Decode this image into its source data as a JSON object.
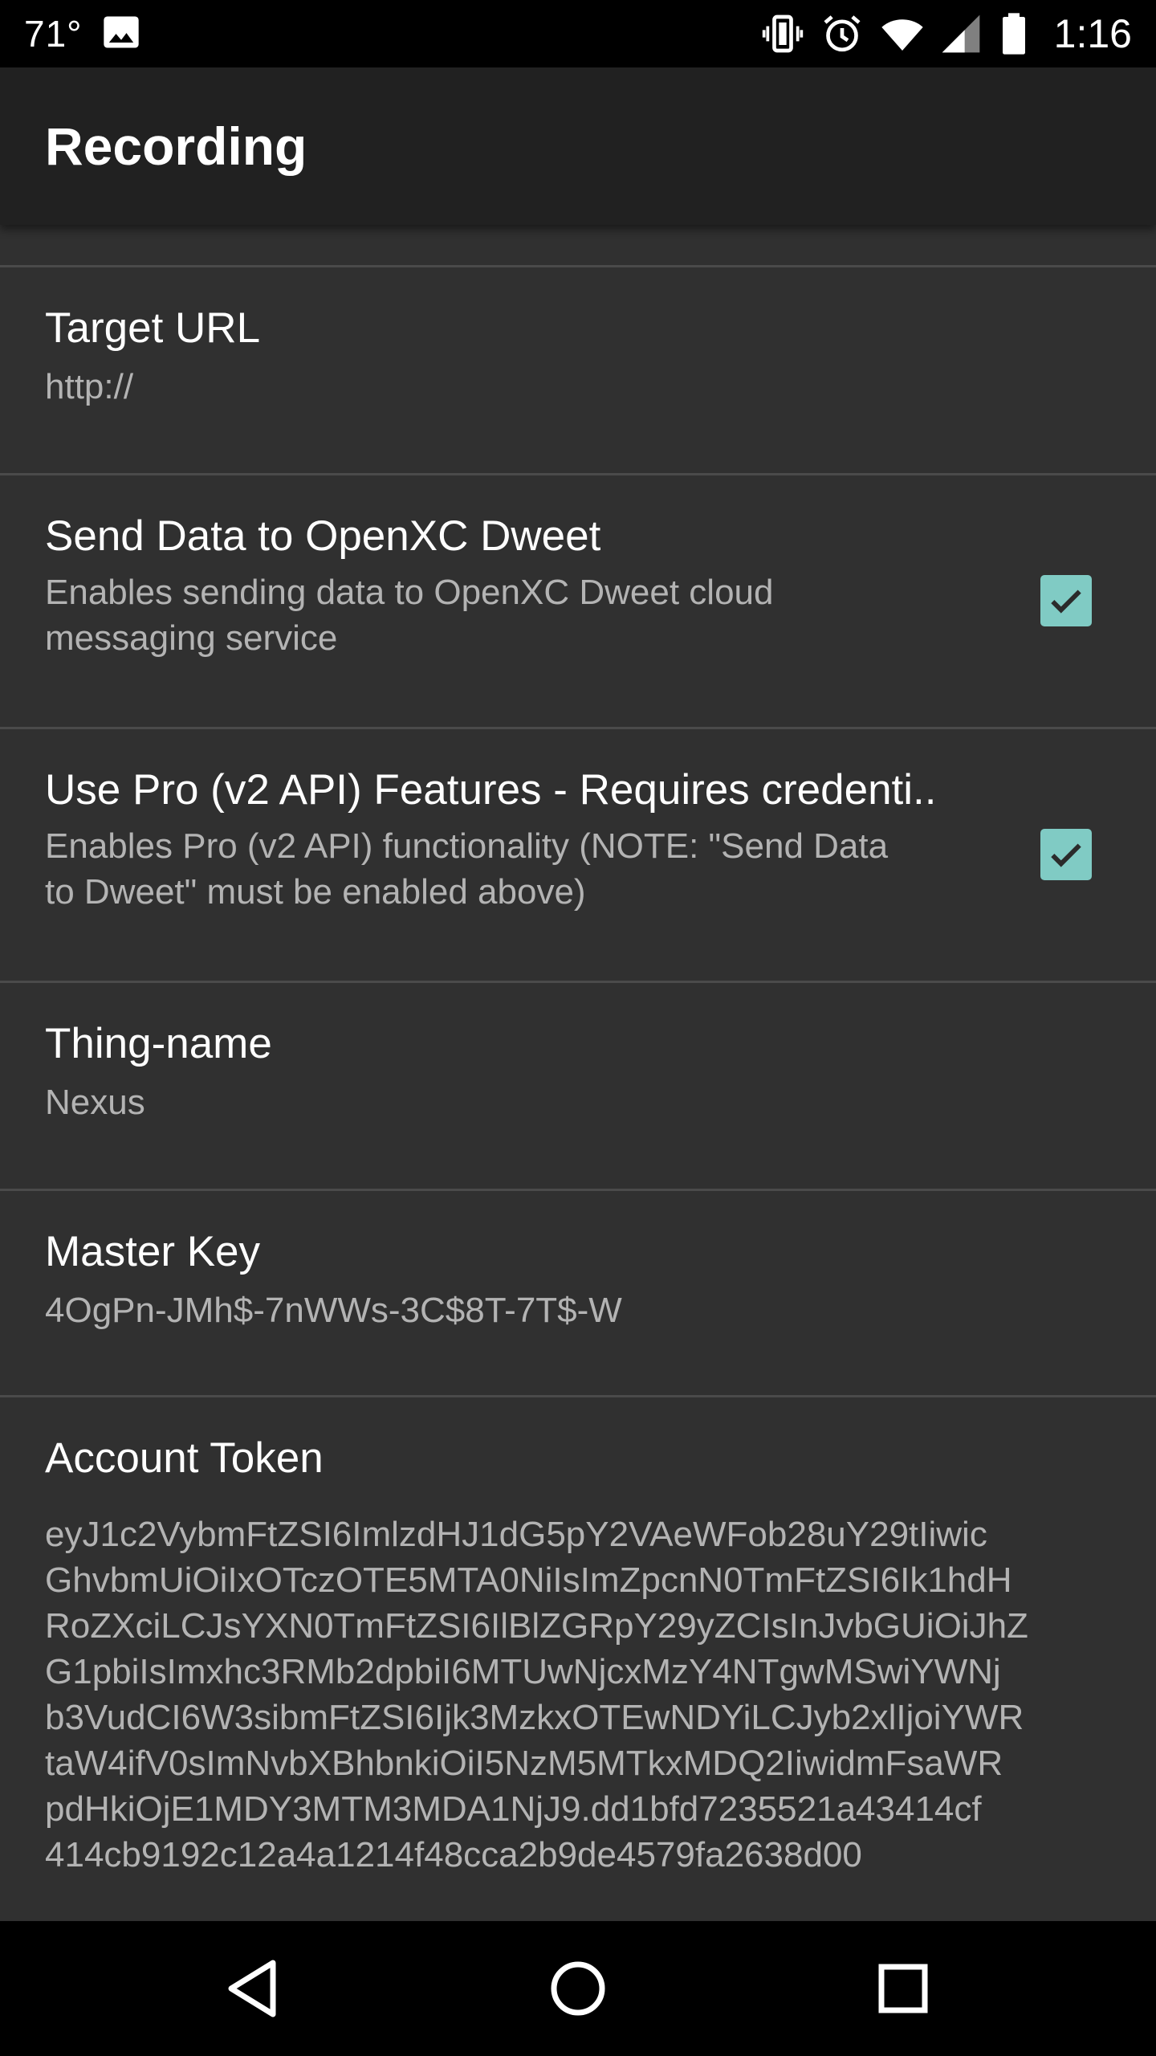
{
  "status_bar": {
    "temperature": "71°",
    "time": "1:16",
    "icons": [
      "image-icon",
      "vibrate-icon",
      "alarm-icon",
      "wifi-icon",
      "cell-signal-icon",
      "battery-icon"
    ]
  },
  "app_bar": {
    "title": "Recording"
  },
  "preferences": {
    "target_url": {
      "title": "Target URL",
      "summary": "http://"
    },
    "send_dweet": {
      "title": "Send Data to OpenXC Dweet",
      "summary_line1": "Enables sending data to OpenXC Dweet cloud",
      "summary_line2": "messaging service",
      "checked": true
    },
    "use_pro": {
      "title": "Use Pro (v2 API) Features - Requires credenti..",
      "summary_line1": "Enables Pro (v2 API) functionality (NOTE: \"Send Data",
      "summary_line2": "to Dweet\" must be enabled above)",
      "checked": true
    },
    "thing_name": {
      "title": "Thing-name",
      "summary": "Nexus"
    },
    "master_key": {
      "title": "Master Key",
      "summary": "4OgPn-JMh$-7nWWs-3C$8T-7T$-W"
    },
    "account_token": {
      "title": "Account Token",
      "lines": [
        "eyJ1c2VybmFtZSI6ImlzdHJ1dG5pY2VAeWFob28uY29tIiwic",
        "GhvbmUiOiIxOTczOTE5MTA0NiIsImZpcnN0TmFtZSI6Ik1hdH",
        "RoZXciLCJsYXN0TmFtZSI6IlBlZGRpY29yZCIsInJvbGUiOiJhZ",
        "G1pbiIsImxhc3RMb2dpbiI6MTUwNjcxMzY4NTgwMSwiYWNj",
        "b3VudCI6W3sibmFtZSI6Ijk3MzkxOTEwNDYiLCJyb2xlIjoiYWR",
        "taW4ifV0sImNvbXBhbnkiOiI5NzM5MTkxMDQ2IiwidmFsaWR",
        "pdHkiOjE1MDY3MTM3MDA1NjJ9.dd1bfd7235521a43414cf",
        "414cb9192c12a4a1214f48cca2b9de4579fa2638d00"
      ]
    }
  },
  "nav_bar": {
    "buttons": [
      "back-icon",
      "home-icon",
      "recents-icon"
    ]
  },
  "colors": {
    "accent": "#80cbc4",
    "background": "#303030",
    "app_bar": "#212121"
  }
}
